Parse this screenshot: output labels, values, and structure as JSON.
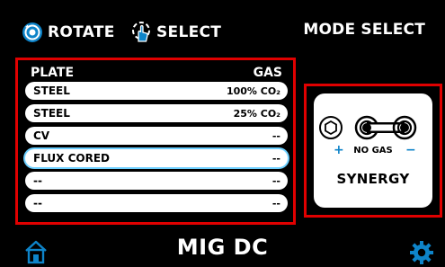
{
  "header": {
    "rotate_label": "ROTATE",
    "select_label": "SELECT",
    "mode_select_label": "MODE SELECT"
  },
  "table": {
    "columns": {
      "plate": "PLATE",
      "gas": "GAS"
    },
    "rows": [
      {
        "plate": "STEEL",
        "gas": "100% CO₂"
      },
      {
        "plate": "STEEL",
        "gas": "25% CO₂"
      },
      {
        "plate": "CV",
        "gas": "--"
      },
      {
        "plate": "FLUX CORED",
        "gas": "--"
      },
      {
        "plate": "--",
        "gas": "--"
      },
      {
        "plate": "--",
        "gas": "--"
      }
    ],
    "selected_row": 3
  },
  "mode_card": {
    "plus": "+",
    "minus": "−",
    "gas_label": "NO GAS",
    "mode_label": "SYNERGY"
  },
  "footer": {
    "process_title": "MIG DC"
  },
  "colors": {
    "frame_red": "#e00000",
    "accent_blue": "#0e84c9",
    "selection_glow": "#6ed0ff",
    "background": "#000000"
  },
  "icons": {
    "rotate": "rotate-knob-icon",
    "select": "press-hand-icon",
    "home": "home-icon",
    "settings": "gear-icon"
  }
}
